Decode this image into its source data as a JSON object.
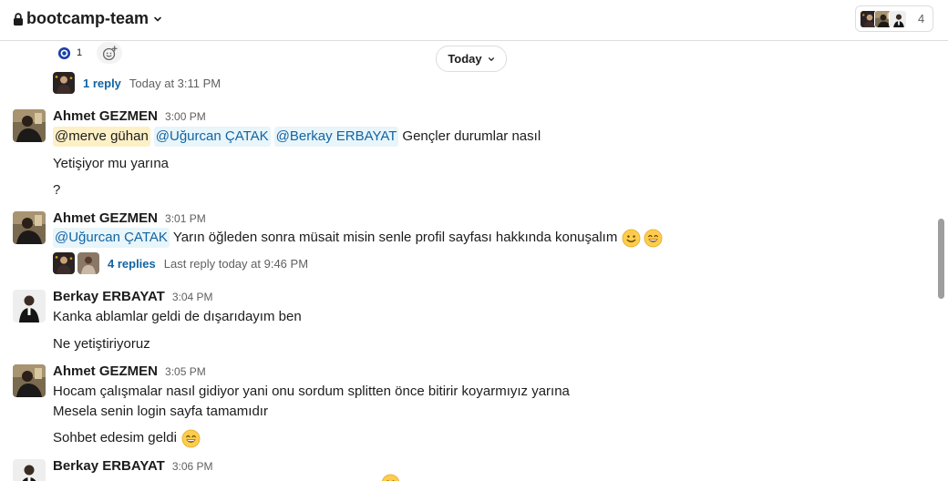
{
  "header": {
    "channel": "bootcamp-team",
    "member_count": "4"
  },
  "date_divider": {
    "label": "Today"
  },
  "top_thread": {
    "reaction_count": "1",
    "replies": "1 reply",
    "last": "Today at 3:11 PM"
  },
  "messages": [
    {
      "sender": "Ahmet GEZMEN",
      "time": "3:00 PM",
      "mention1": "@merve gühan",
      "mention2": "@Uğurcan ÇATAK",
      "mention3": "@Berkay ERBAYAT",
      "text1": "Gençler durumlar nasıl",
      "text2": "Yetişiyor mu yarına",
      "text3": "?"
    },
    {
      "sender": "Ahmet GEZMEN",
      "time": "3:01 PM",
      "mention1": "@Uğurcan ÇATAK",
      "text1": "Yarın öğleden sonra müsait misin senle profil sayfası hakkında konuşalım",
      "thread_replies": "4 replies",
      "thread_last": "Last reply today at 9:46 PM"
    },
    {
      "sender": "Berkay ERBAYAT",
      "time": "3:04 PM",
      "text1": "Kanka ablamlar geldi de dışarıdayım ben",
      "text2": "Ne yetiştiriyoruz"
    },
    {
      "sender": "Ahmet GEZMEN",
      "time": "3:05 PM",
      "text1": "Hocam çalışmalar nasıl gidiyor yani onu sordum splitten önce bitirir koyarmıyız yarına",
      "text2": "Mesela senin login sayfa tamamıdır",
      "text3": "Sohbet edesim geldi"
    },
    {
      "sender": "Berkay ERBAYAT",
      "time": "3:06 PM"
    }
  ],
  "icons": {
    "lock": "lock-icon",
    "chevron": "chevron-down-icon",
    "add_reaction": "add-reaction-icon",
    "emoji_smile": "slightly-smiling-face",
    "emoji_grin": "grinning-face-with-smiling-eyes"
  },
  "colors": {
    "link": "#1264a3",
    "mention_bg": "#e8f5fa",
    "self_mention_bg": "#fdf0c6"
  }
}
